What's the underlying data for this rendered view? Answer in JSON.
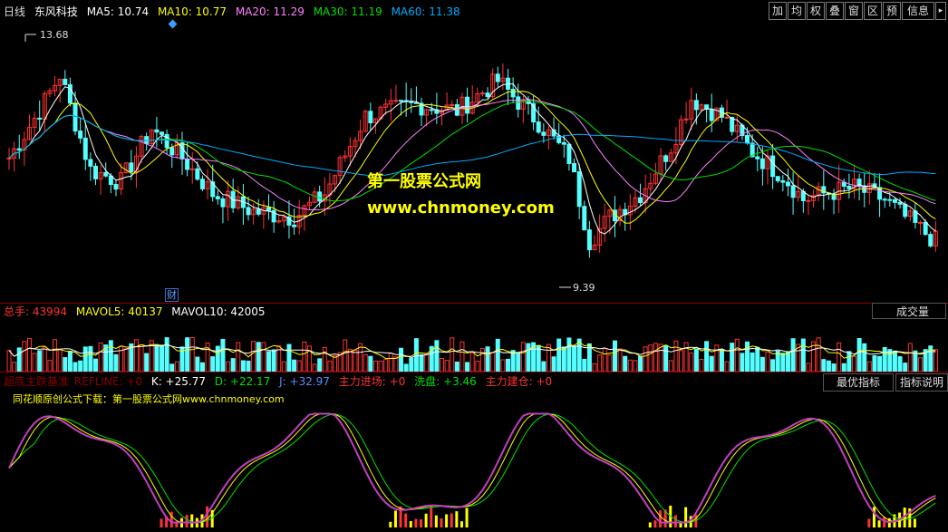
{
  "main_header": {
    "period": "日线",
    "stock_name": "东风科技",
    "ma5": "MA5: 10.74",
    "ma10": "MA10: 10.77",
    "ma20": "MA20: 11.29",
    "ma30": "MA30: 11.19",
    "ma60": "MA60: 11.38"
  },
  "toolbar": [
    "加",
    "均",
    "权",
    "叠",
    "窗",
    "区",
    "预",
    "信息"
  ],
  "price_chart": {
    "high_label": "13.68",
    "low_label": "9.39",
    "marker_label": "财",
    "watermark_title": "第一股票公式网",
    "watermark_url": "www.chnmoney.com"
  },
  "volume_header": {
    "total": "总手: 43994",
    "mavol5": "MAVOL5: 40137",
    "mavol10": "MAVOL10: 42005",
    "dropdown": "成交量"
  },
  "indicator_header": {
    "name": "超底主跌基准",
    "refline": "REFLINE: +0",
    "k": "K: +25.77",
    "d": "D: +22.17",
    "j": "J: +32.97",
    "zhuli": "主力进场: +0",
    "xipan": "洗盘: +3.46",
    "jiancang": "主力建仓: +0",
    "note": "同花顺原创公式下载：第一股票公式网www.chnmoney.com",
    "btn_best": "最优指标",
    "btn_help": "指标说明"
  },
  "colors": {
    "up": "#ff3232",
    "down": "#54ffff",
    "ma5": "#ffffff",
    "ma10": "#ffff00",
    "ma20": "#ff80ff",
    "ma30": "#00e000",
    "ma60": "#00aaff"
  }
}
